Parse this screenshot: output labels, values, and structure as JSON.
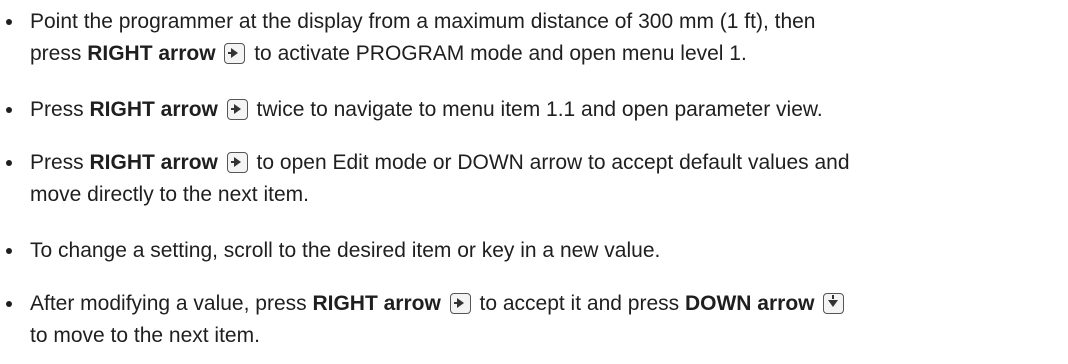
{
  "colors": {
    "text": "#1f1f1f",
    "key_border": "#555555"
  },
  "icons": {
    "right_key": "right-arrow-key-icon",
    "down_key": "down-arrow-key-icon"
  },
  "bullets": [
    {
      "line1_pre": "Point the programmer at the display from a maximum distance of 300 mm (1 ft), then",
      "line2_pre": "press ",
      "bold": "RIGHT arrow",
      "line2_post": " to activate PROGRAM mode and open menu level 1."
    },
    {
      "pre": "Press ",
      "bold": "RIGHT arrow",
      "post": " twice to navigate to menu item 1.1 and open parameter view."
    },
    {
      "pre": "Press ",
      "bold": "RIGHT arrow",
      "post": " to open Edit mode or DOWN arrow to accept default values and",
      "line2": "move directly to the next item."
    },
    {
      "text": "To change a setting, scroll to the desired item or key in a new value."
    },
    {
      "pre": "After modifying a value, press ",
      "bold": "RIGHT arrow",
      "mid": " to accept it and press ",
      "bold2": "DOWN arrow",
      "line2": "to move to the next item."
    }
  ]
}
